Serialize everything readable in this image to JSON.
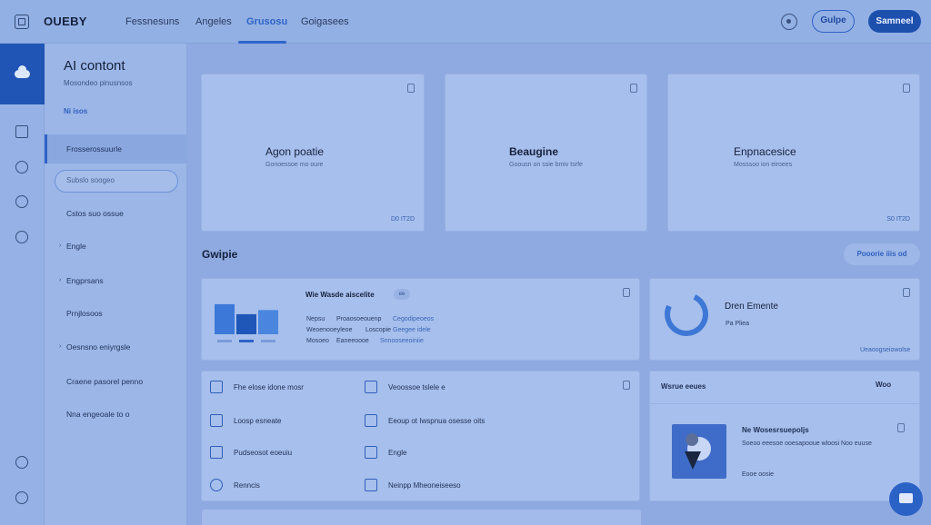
{
  "topbar": {
    "brand": "OUEBY",
    "nav": [
      "Fessnesuns",
      "Angeles",
      "Grusosu",
      "Goigasees"
    ],
    "active_nav": "Grusosu",
    "btn_outline": "Gulpe",
    "btn_solid": "Samneel"
  },
  "sidebar": {
    "title": "AI contont",
    "subtitle": "Mosondeo pinusnsos",
    "link": "Ni isos",
    "search_placeholder": "Subslo soogeo",
    "items": [
      {
        "label": "Frosserossuurle"
      },
      {
        "label": "Cstos suo ossue"
      },
      {
        "label": "Engle"
      },
      {
        "label": "Engprsans"
      },
      {
        "label": "Prnjlosoos"
      },
      {
        "label": "Oesnsno eniyrgsle"
      },
      {
        "label": "Craene pasorel penno"
      },
      {
        "label": "Nna engeoale to o"
      }
    ]
  },
  "cards": [
    {
      "title": "Agon poatie",
      "sub": "Gonoessoe mo oure",
      "foot": "D0 IT2D"
    },
    {
      "title": "Beaugine",
      "sub": "Goousn on ssie bmiv tsrfe",
      "foot": ""
    },
    {
      "title": "Enpnacesice",
      "sub": "Mosssoo ion eiroees",
      "foot": "S0 IT2D"
    }
  ],
  "section": {
    "title": "Gwipie",
    "button": "Pooorie iiis od"
  },
  "chart_card": {
    "title": "Wie Wasde aiscelite",
    "chip": "ee",
    "rows": [
      [
        "Nepsu",
        "Proaosoeouenp",
        "Cegodipeoeos"
      ],
      [
        "Weoenooeyleoe",
        "Loscopie",
        "Geegee idele"
      ],
      [
        "Mosoeo",
        "Eaneeoooe",
        "Snnooseeoiniie"
      ]
    ]
  },
  "chart_data": {
    "type": "bar",
    "categories": [
      "",
      "",
      ""
    ],
    "values": [
      72,
      48,
      58
    ],
    "ylim": [
      0,
      100
    ]
  },
  "donut_card": {
    "title": "Dren Emente",
    "meta": "Pa Pliea",
    "foot": "Ueaoogseiowolse"
  },
  "list": [
    {
      "label": "Fhe elose idone mosr",
      "icon": "clipboard-icon"
    },
    {
      "label": "Veoossoe tslele e",
      "icon": "folder-icon"
    },
    {
      "label": "Loosp esneate",
      "icon": "card-icon"
    },
    {
      "label": "Eeoup ot Iwspnua osesse oits",
      "icon": "transfer-icon"
    },
    {
      "label": "Pudseosot eoeuiu",
      "icon": "user-icon"
    },
    {
      "label": "Engle",
      "icon": "tools-icon"
    },
    {
      "label": "Renncis",
      "icon": "headset-icon"
    },
    {
      "label": "Neinpp Mheoneiseeso",
      "icon": "check-box-icon"
    }
  ],
  "right_card": {
    "header": "Wsrue eeues",
    "header_right": "Woo",
    "item_title": "Ne Wosesrsuepoljs",
    "item_sub": "Soeoo eeesoe ooesapooue wloosi Noo euuse",
    "item_meta": "Eooe oosie"
  },
  "colors": {
    "accent": "#2f63c6",
    "bg": "#8eaae0",
    "card": "#a7bfec"
  }
}
